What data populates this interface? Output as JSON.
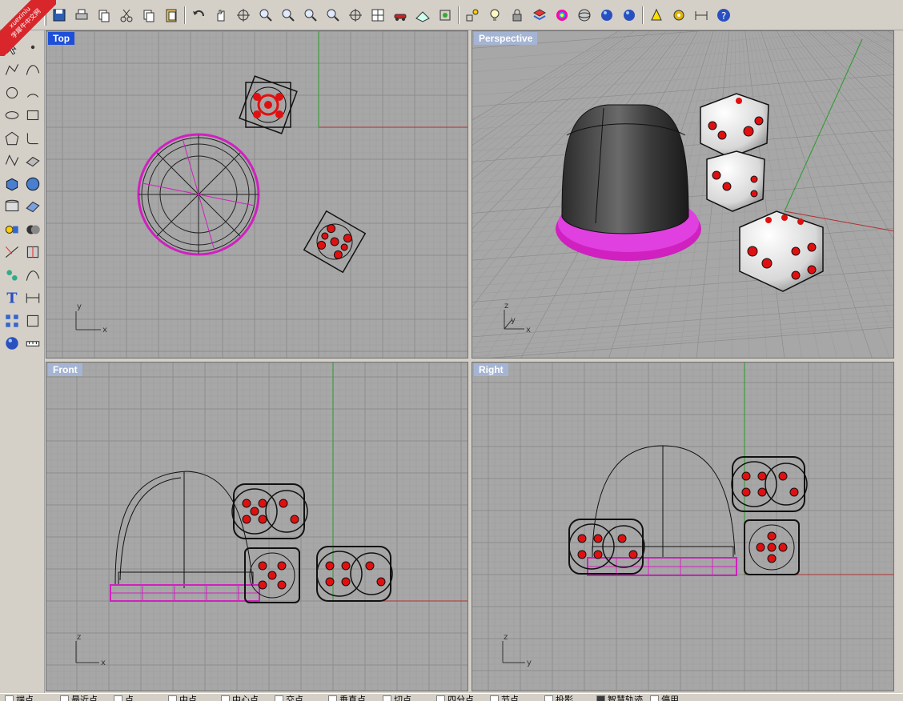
{
  "watermark": {
    "line1": "xuexiniu",
    "line2": "学犀牛中文网"
  },
  "toolbar": {
    "icons": [
      "save-icon",
      "print-icon",
      "copy-to-clipboard-icon",
      "cut-icon",
      "copy-icon",
      "paste-icon",
      "undo-icon",
      "pan-hand-icon",
      "rotate-view-icon",
      "zoom-icon",
      "zoom-window-icon",
      "zoom-extents-icon",
      "zoom-selected-icon",
      "rotate-camera-icon",
      "four-viewports-icon",
      "car-display-icon",
      "grid-plane-icon",
      "cplane-icon",
      "osnap-icon",
      "light-bulb-icon",
      "lock-icon",
      "layer-icon",
      "color-wheel-icon",
      "shaded-sphere-icon",
      "render-sphere-icon",
      "render-preview-icon",
      "analyze-icon",
      "options-gear-icon",
      "dimension-icon",
      "help-icon"
    ]
  },
  "left_toolbar": {
    "icons": [
      "select-icon",
      "point-icon",
      "polyline-icon",
      "curve-icon",
      "circle-icon",
      "arc-icon",
      "ellipse-icon",
      "rectangle-icon",
      "polygon-icon",
      "fillet-icon",
      "freeform-icon",
      "surface-icon",
      "box-solid-icon",
      "sphere-solid-icon",
      "cylinder-icon",
      "plane-surface-icon",
      "transform-icon",
      "boolean-icon",
      "trim-icon",
      "split-icon",
      "group-icon",
      "curve-from-object-icon",
      "text-icon",
      "dimension-tool-icon",
      "array-icon",
      "analysis-tool-icon",
      "render-mesh-icon",
      "measure-icon"
    ]
  },
  "viewports": {
    "top": {
      "label": "Top",
      "axis_x": "x",
      "axis_y": "y"
    },
    "perspective": {
      "label": "Perspective",
      "axis_x": "x",
      "axis_y": "y",
      "axis_z": "z"
    },
    "front": {
      "label": "Front",
      "axis_x": "x",
      "axis_z": "z"
    },
    "right": {
      "label": "Right",
      "axis_y": "y",
      "axis_z": "z"
    }
  },
  "colors": {
    "viewport_bg": "#a7a7a7",
    "grid_line": "#999999",
    "axis_red": "#b03030",
    "axis_green": "#2a9a2a",
    "selection_magenta": "#d020c0",
    "dice_red": "#e01010",
    "active_label": "#1d4fd8",
    "inactive_label": "#a5b4d2"
  },
  "statusbar": {
    "snaps": [
      {
        "label": "端点",
        "checked": false
      },
      {
        "label": "最近点",
        "checked": false
      },
      {
        "label": "点",
        "checked": false
      },
      {
        "label": "中点",
        "checked": false
      },
      {
        "label": "中心点",
        "checked": false
      },
      {
        "label": "交点",
        "checked": false
      },
      {
        "label": "垂直点",
        "checked": false
      },
      {
        "label": "切点",
        "checked": false
      },
      {
        "label": "四分点",
        "checked": false
      },
      {
        "label": "节点",
        "checked": false
      },
      {
        "label": "投影",
        "checked": false
      },
      {
        "label": "智慧轨迹",
        "checked": true
      },
      {
        "label": "停用",
        "checked": false
      }
    ]
  }
}
